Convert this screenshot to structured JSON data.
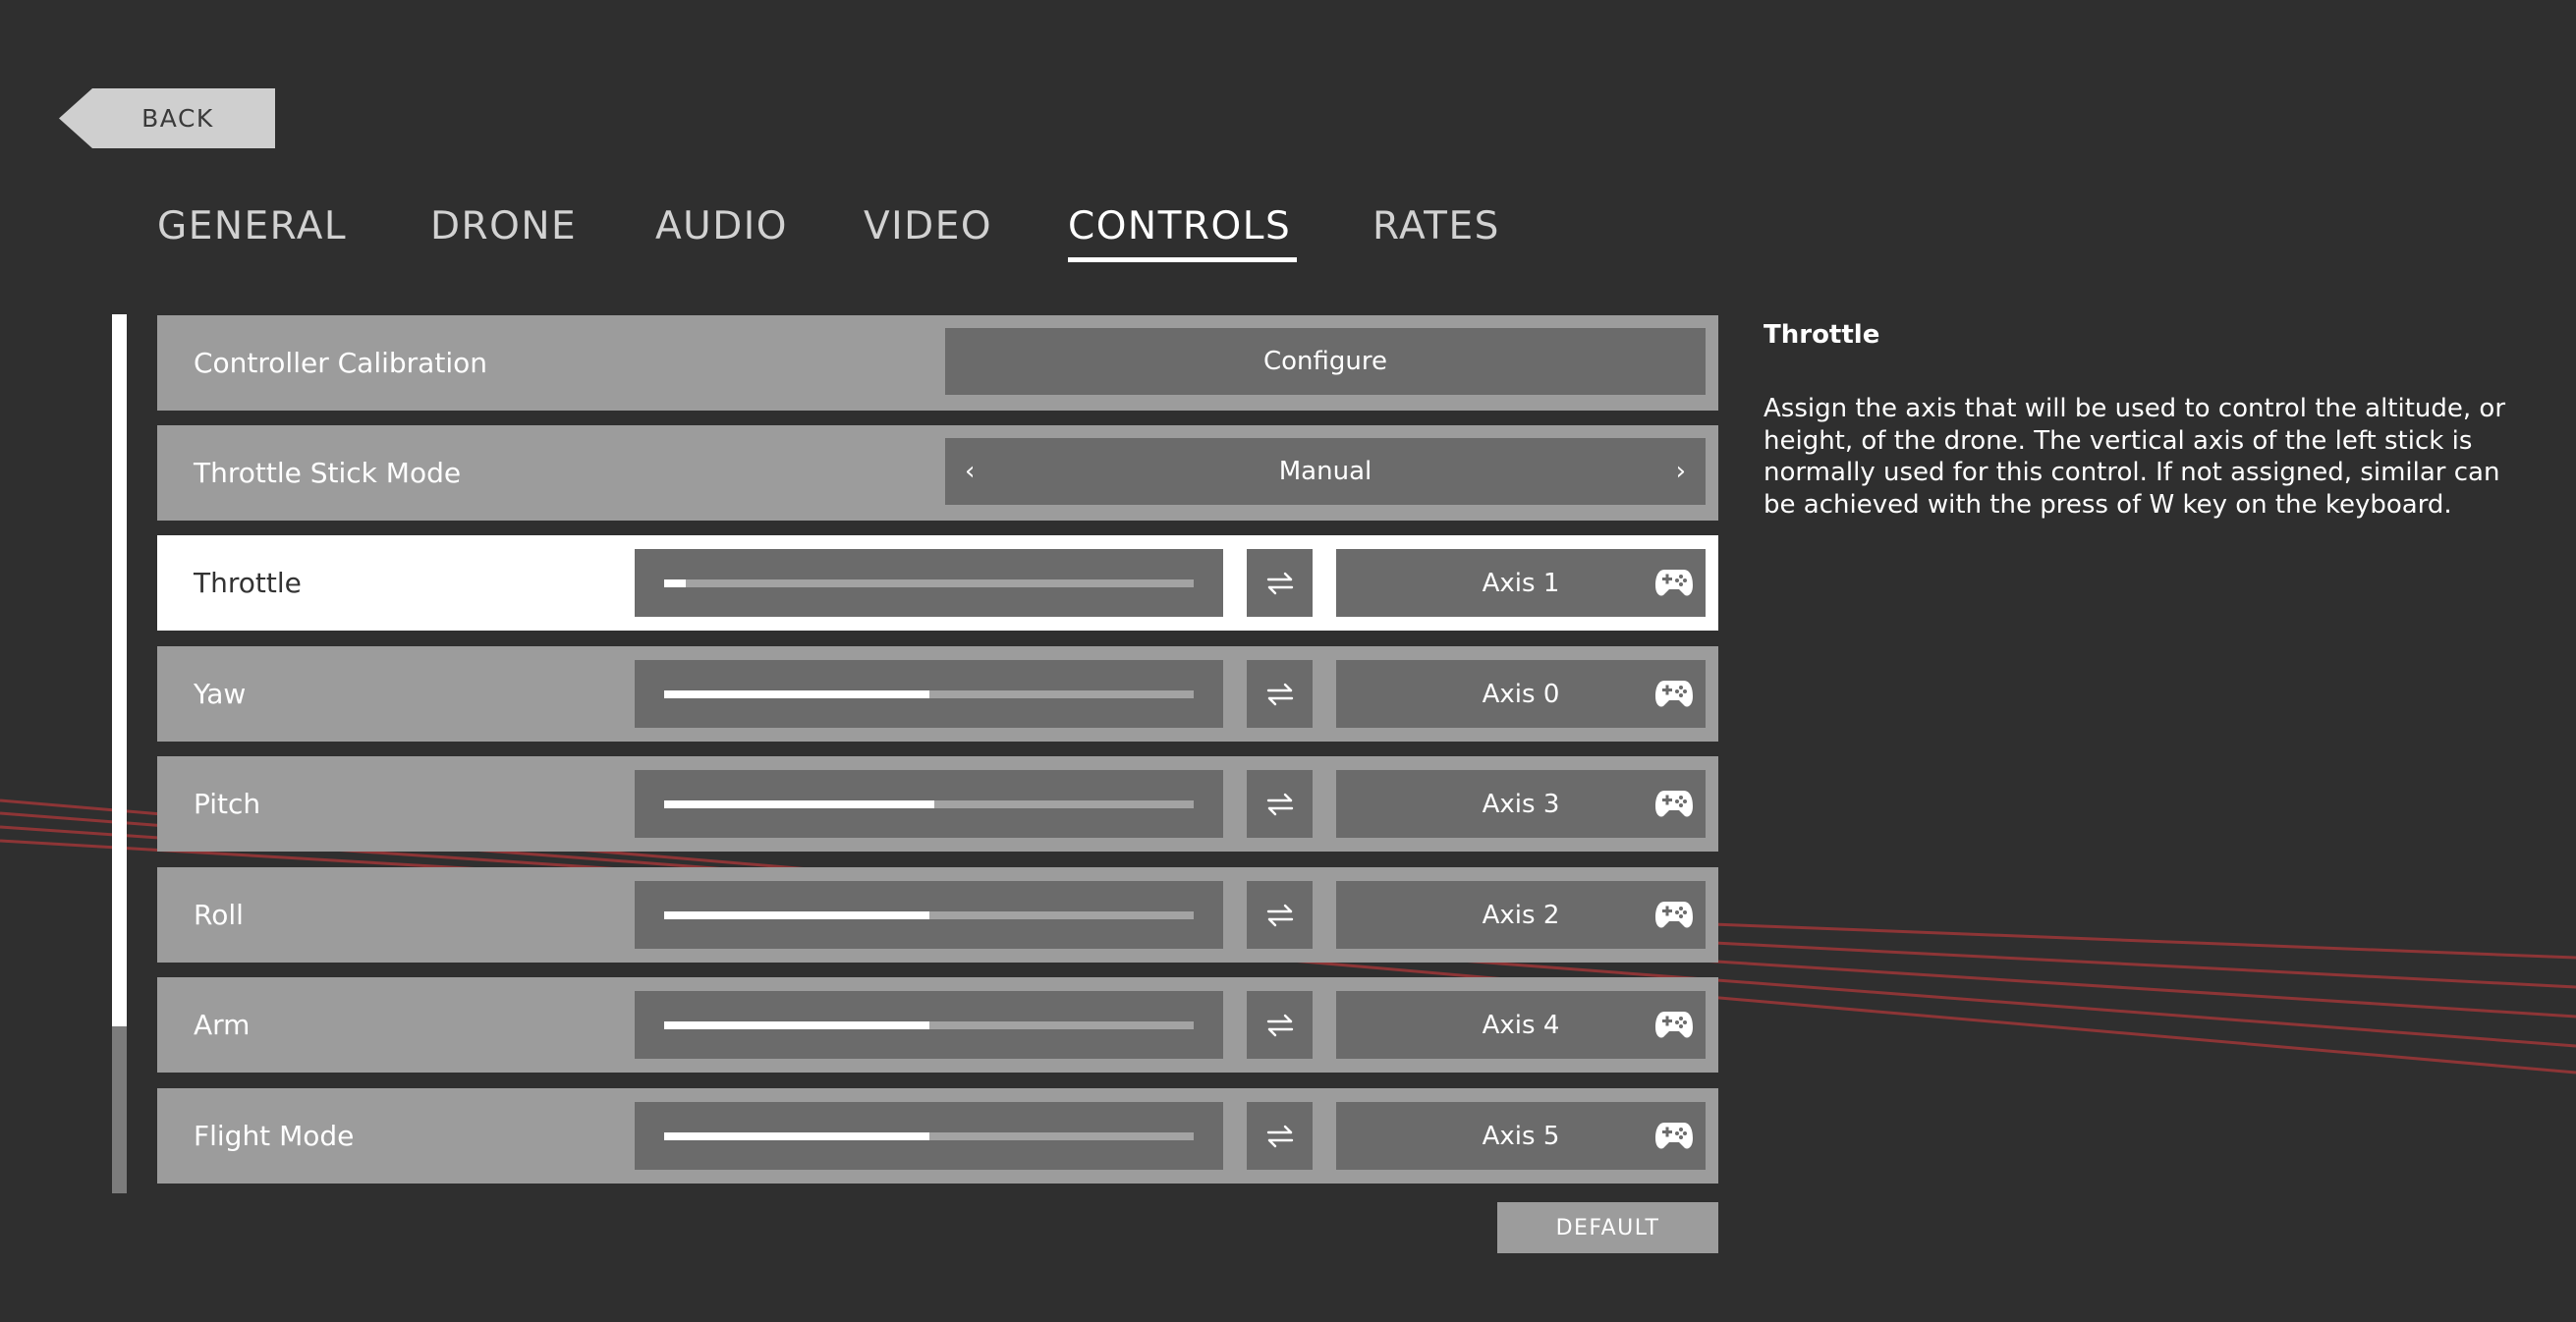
{
  "back_label": "BACK",
  "tabs": [
    {
      "label": "GENERAL",
      "active": false
    },
    {
      "label": "DRONE",
      "active": false
    },
    {
      "label": "AUDIO",
      "active": false
    },
    {
      "label": "VIDEO",
      "active": false
    },
    {
      "label": "CONTROLS",
      "active": true
    },
    {
      "label": "RATES",
      "active": false
    }
  ],
  "calibration": {
    "label": "Controller Calibration",
    "button": "Configure"
  },
  "throttle_mode": {
    "label": "Throttle Stick Mode",
    "value": "Manual",
    "prev_glyph": "‹",
    "next_glyph": "›"
  },
  "axes": [
    {
      "label": "Throttle",
      "value": 0.04,
      "axis": "Axis 1",
      "selected": true
    },
    {
      "label": "Yaw",
      "value": 0.5,
      "axis": "Axis 0",
      "selected": false
    },
    {
      "label": "Pitch",
      "value": 0.51,
      "axis": "Axis 3",
      "selected": false
    },
    {
      "label": "Roll",
      "value": 0.5,
      "axis": "Axis 2",
      "selected": false
    },
    {
      "label": "Arm",
      "value": 0.5,
      "axis": "Axis 4",
      "selected": false
    },
    {
      "label": "Flight Mode",
      "value": 0.5,
      "axis": "Axis 5",
      "selected": false
    }
  ],
  "scrollbar": {
    "visible_fraction": 0.81
  },
  "default_label": "DEFAULT",
  "help": {
    "title": "Throttle",
    "body": "Assign the axis that will be used to control the altitude, or height, of the drone. The vertical axis of the left stick is normally used for this control. If not assigned, similar can be achieved with the press of W key on the keyboard."
  },
  "colors": {
    "accent": "#ffffff",
    "row": "#9c9c9c",
    "field": "#6b6b6b",
    "background": "#2f2f2f",
    "laser": "#c0393b"
  },
  "icons": {
    "invert": "swap-arrows-icon",
    "axis": "gamepad-icon",
    "back": "arrow-left-shape"
  }
}
